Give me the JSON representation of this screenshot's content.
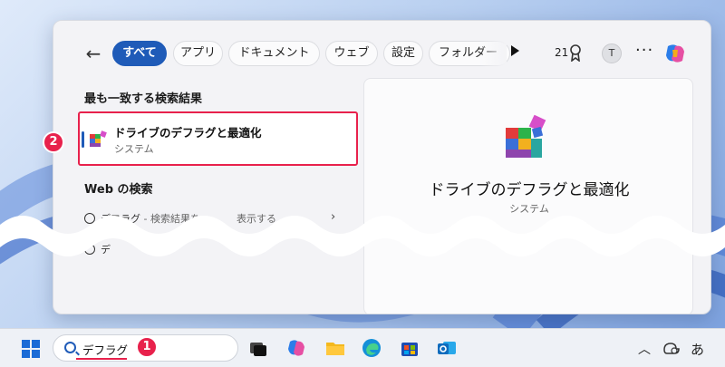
{
  "search_panel": {
    "filters": [
      "すべて",
      "アプリ",
      "ドキュメント",
      "ウェブ",
      "設定",
      "フォルダー"
    ],
    "active_filter": "すべて",
    "count": "21",
    "avatar_initial": "T",
    "more": "···"
  },
  "best_match": {
    "section_title": "最も一致する検索結果",
    "app_name": "ドライブのデフラグと最適化",
    "app_type": "システム"
  },
  "web_search": {
    "section_title": "Web の検索",
    "query": "デフラグ",
    "hint": " - 検索結果を",
    "hint_tail": "表示する",
    "second_row": "デ"
  },
  "preview": {
    "app_name": "ドライブのデフラグと最適化",
    "app_type": "システム"
  },
  "taskbar": {
    "search_value": "デフラグ",
    "ime": "あ"
  },
  "annotations": {
    "step1": "1",
    "step2": "2"
  },
  "colors": {
    "accent": "#1f5bb8",
    "highlight": "#e8214c"
  }
}
